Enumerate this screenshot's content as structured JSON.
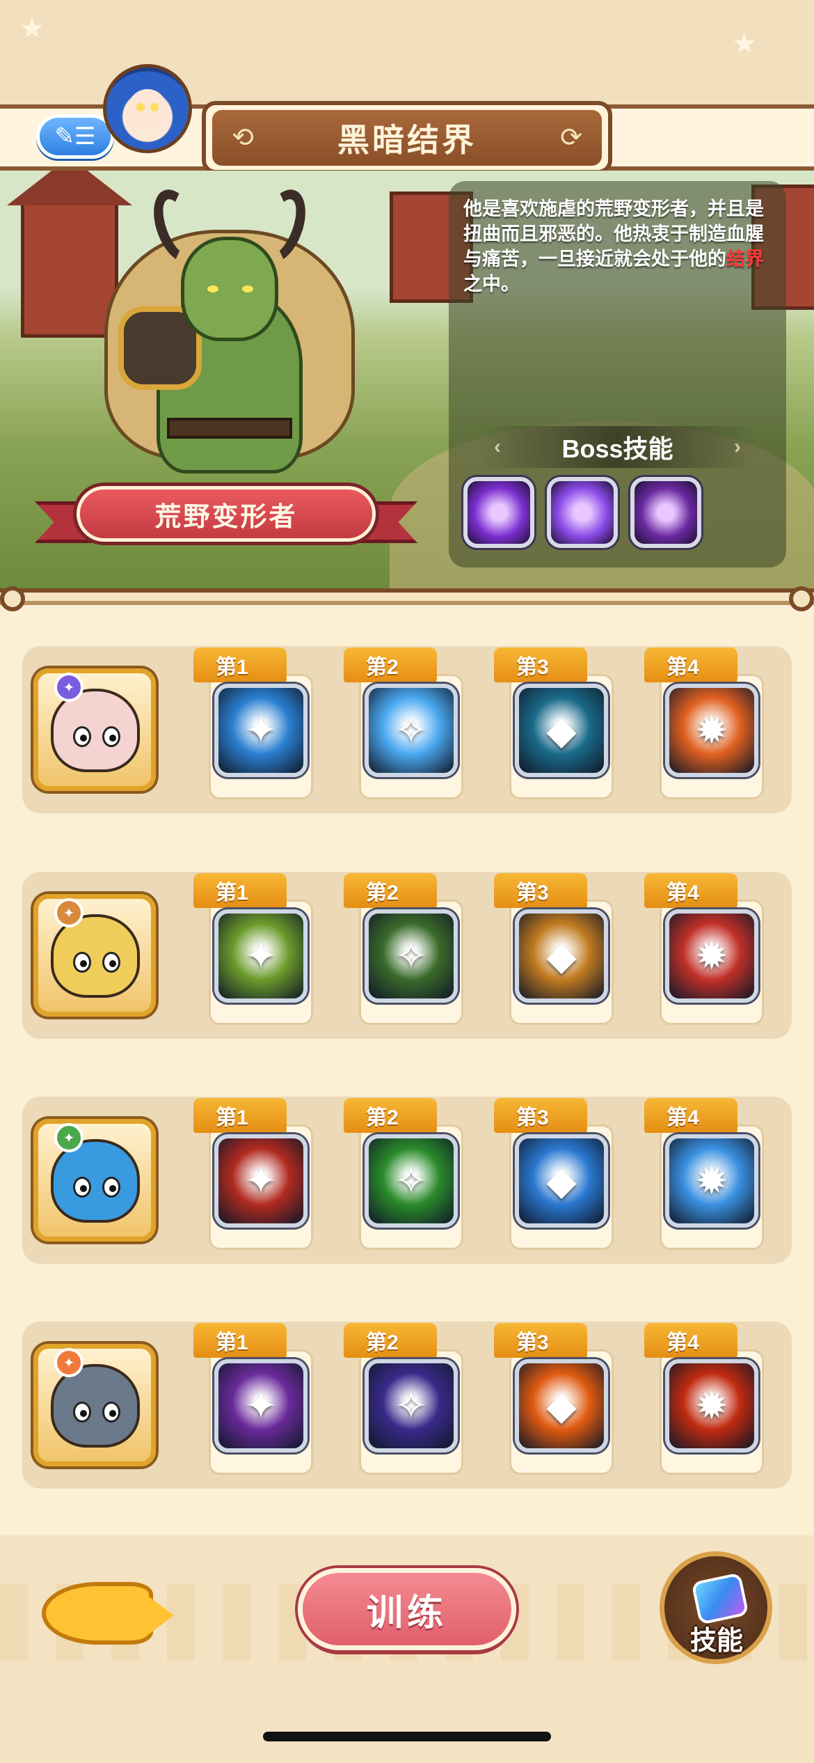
{
  "header": {
    "title": "黑暗结界",
    "back_icon": "back-list-icon"
  },
  "boss": {
    "name": "荒野变形者",
    "description_before": "他是喜欢施虐的荒野变形者，并且是扭曲而且邪恶的。他热衷于制造血腥与痛苦，一旦接近就会处于他的",
    "description_highlight": "结界",
    "description_after": "之中。",
    "highlight_color": "#ff3a3a",
    "skills_title": "Boss技能",
    "skills": [
      {
        "icon": "dark-summon-icon",
        "color": "#7b2fd0"
      },
      {
        "icon": "purple-cloud-icon",
        "color": "#8a4ae8"
      },
      {
        "icon": "dark-orb-icon",
        "color": "#6a2aa0"
      }
    ]
  },
  "rows": [
    {
      "hero": "pink-hippo-hero",
      "class_icon": "mage-class-icon",
      "class_color": "#7a5ce0",
      "hero_color": "#f4d3d0",
      "skills": [
        {
          "tag": "第1",
          "icon": "ice-spike-icon",
          "bg": "#2a7fd0"
        },
        {
          "tag": "第2",
          "icon": "ice-shard-icon",
          "bg": "#4aa8f0"
        },
        {
          "tag": "第3",
          "icon": "red-mask-icon",
          "bg": "#1a6a8a"
        },
        {
          "tag": "第4",
          "icon": "hammer-icon",
          "bg": "#e06020"
        }
      ]
    },
    {
      "hero": "yellow-boar-hero",
      "class_icon": "warrior-class-icon",
      "class_color": "#d88a3a",
      "hero_color": "#f0cd5a",
      "skills": [
        {
          "tag": "第1",
          "icon": "spiked-mace-icon",
          "bg": "#6a9a2a"
        },
        {
          "tag": "第2",
          "icon": "green-knight-icon",
          "bg": "#3a6a2a"
        },
        {
          "tag": "第3",
          "icon": "crystal-strike-icon",
          "bg": "#c07a20"
        },
        {
          "tag": "第4",
          "icon": "red-axe-icon",
          "bg": "#c03028"
        }
      ]
    },
    {
      "hero": "blue-fish-hero",
      "class_icon": "ranger-class-icon",
      "class_color": "#4aa84a",
      "hero_color": "#3a9ae0",
      "skills": [
        {
          "tag": "第1",
          "icon": "flail-strike-icon",
          "bg": "#b02a20"
        },
        {
          "tag": "第2",
          "icon": "poison-dagger-icon",
          "bg": "#2a8a2a"
        },
        {
          "tag": "第3",
          "icon": "water-spirit-icon",
          "bg": "#2a78d0"
        },
        {
          "tag": "第4",
          "icon": "ice-spear-icon",
          "bg": "#3a90e0"
        }
      ]
    },
    {
      "hero": "grey-hippo-hero",
      "class_icon": "beast-class-icon",
      "class_color": "#f07a3a",
      "hero_color": "#6a7a8a",
      "skills": [
        {
          "tag": "第1",
          "icon": "purple-burst-icon",
          "bg": "#6a2a9a"
        },
        {
          "tag": "第2",
          "icon": "shadow-swirl-icon",
          "bg": "#3a2a8a"
        },
        {
          "tag": "第3",
          "icon": "paw-print-icon",
          "bg": "#e05a10"
        },
        {
          "tag": "第4",
          "icon": "fire-bomb-icon",
          "bg": "#c02a10"
        }
      ]
    }
  ],
  "bottom": {
    "train_label": "训练",
    "skill_label": "技能",
    "fish_icon": "fish-bone-icon"
  }
}
